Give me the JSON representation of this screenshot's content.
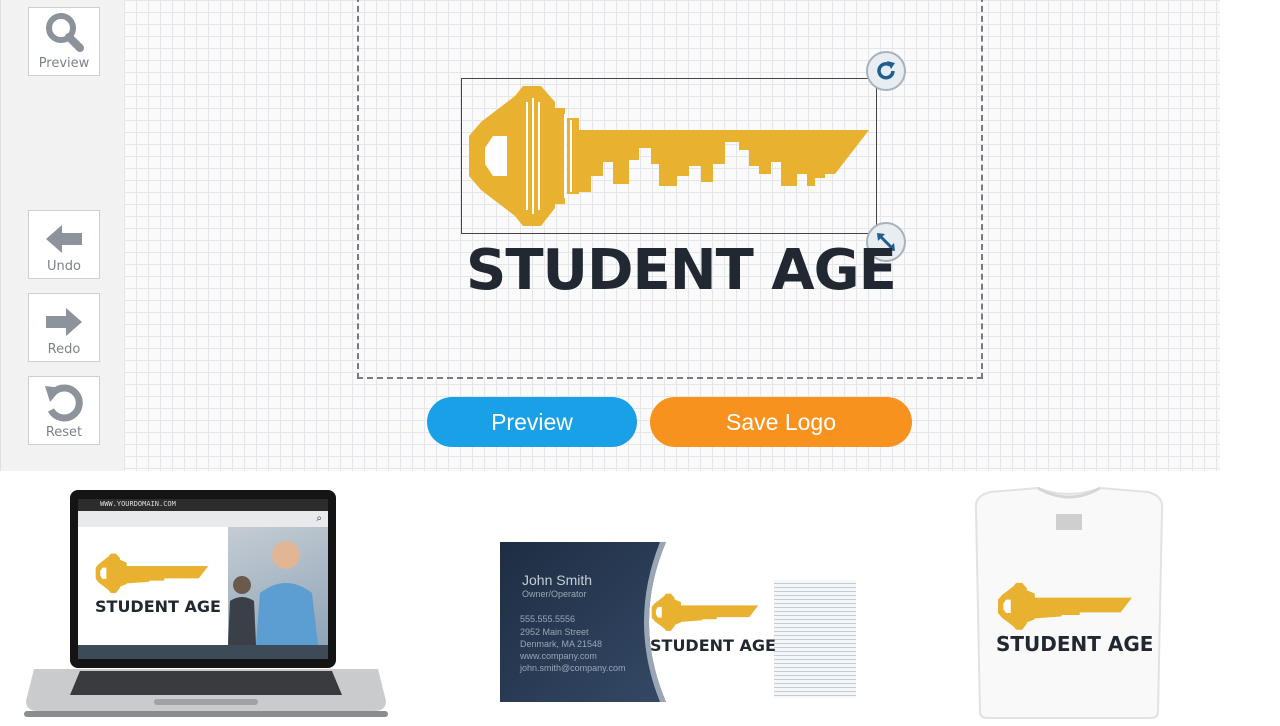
{
  "sidebar": {
    "tools": [
      {
        "label": "Preview",
        "icon": "magnifier-icon"
      },
      {
        "label": "Undo",
        "icon": "arrow-left-icon"
      },
      {
        "label": "Redo",
        "icon": "arrow-right-icon"
      },
      {
        "label": "Reset",
        "icon": "reset-icon"
      }
    ]
  },
  "canvas": {
    "logo_text": "STUDENT AGE",
    "rotate_handle_icon": "rotate-icon",
    "resize_handle_icon": "resize-icon"
  },
  "actions": {
    "preview_label": "Preview",
    "save_label": "Save Logo"
  },
  "colors": {
    "key_gold": "#e9b130",
    "logo_text": "#222831",
    "preview_button": "#1aa0e6",
    "save_button": "#f7921e"
  },
  "mockups": {
    "laptop": {
      "url": "WWW.YOURDOMAIN.COM",
      "logo_text": "STUDENT AGE"
    },
    "business_card": {
      "name": "John Smith",
      "title": "Owner/Operator",
      "phone": "555.555.5556",
      "address1": "2952 Main Street",
      "address2": "Denmark, MA 21548",
      "website": "www.company.com",
      "email": "john.smith@company.com",
      "logo_text": "STUDENT AGE"
    },
    "tshirt": {
      "logo_text": "STUDENT AGE"
    }
  }
}
